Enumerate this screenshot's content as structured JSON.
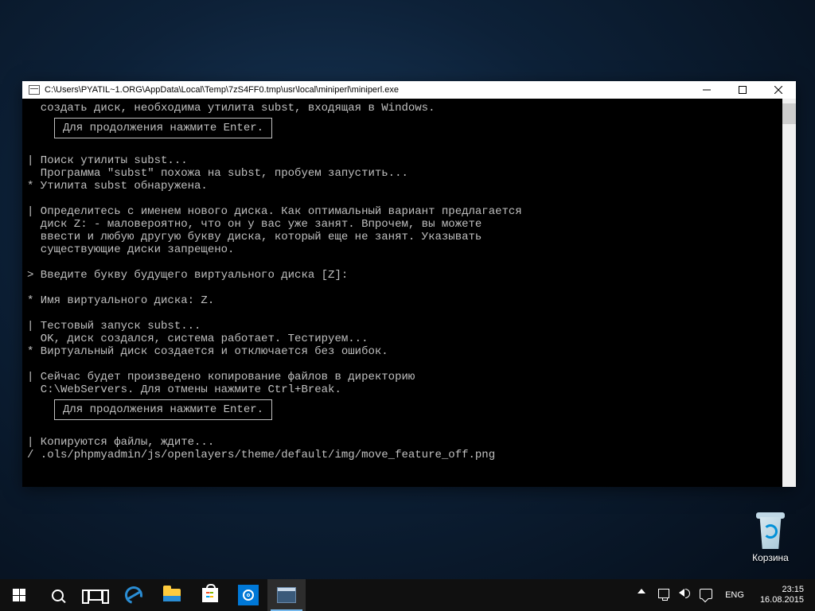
{
  "window": {
    "title": "C:\\Users\\PYATIL~1.ORG\\AppData\\Local\\Temp\\7zS4FF0.tmp\\usr\\local\\miniperl\\miniperl.exe"
  },
  "console": {
    "lines": [
      {
        "p": "  ",
        "t": "создать диск, необходима утилита subst, входящая в Windows."
      },
      {
        "box": true,
        "t": "Для продолжения нажмите Enter."
      },
      {
        "blank": true
      },
      {
        "p": "| ",
        "t": "Поиск утилиты subst..."
      },
      {
        "p": "  ",
        "t": "Программа \"subst\" похожа на subst, пробуем запустить..."
      },
      {
        "p": "* ",
        "t": "Утилита subst обнаружена."
      },
      {
        "blank": true
      },
      {
        "p": "| ",
        "t": "Определитесь с именем нового диска. Как оптимальный вариант предлагается"
      },
      {
        "p": "  ",
        "t": "диск Z: - маловероятно, что он у вас уже занят. Впрочем, вы можете"
      },
      {
        "p": "  ",
        "t": "ввести и любую другую букву диска, который еще не занят. Указывать"
      },
      {
        "p": "  ",
        "t": "существующие диски запрещено."
      },
      {
        "blank": true
      },
      {
        "p": "> ",
        "t": "Введите букву будущего виртуального диска [Z]:"
      },
      {
        "blank": true
      },
      {
        "p": "* ",
        "t": "Имя виртуального диска: Z."
      },
      {
        "blank": true
      },
      {
        "p": "| ",
        "t": "Тестовый запуск subst..."
      },
      {
        "p": "  ",
        "t": "OK, диск создался, система работает. Тестируем..."
      },
      {
        "p": "* ",
        "t": "Виртуальный диск создается и отключается без ошибок."
      },
      {
        "blank": true
      },
      {
        "p": "| ",
        "t": "Сейчас будет произведено копирование файлов в директорию"
      },
      {
        "p": "  ",
        "t": "C:\\WebServers. Для отмены нажмите Ctrl+Break."
      },
      {
        "box": true,
        "t": "Для продолжения нажмите Enter."
      },
      {
        "blank": true
      },
      {
        "p": "| ",
        "t": "Копируются файлы, ждите..."
      },
      {
        "p": "/ ",
        "t": ".ols/phpmyadmin/js/openlayers/theme/default/img/move_feature_off.png"
      }
    ]
  },
  "desktop": {
    "recycle_label": "Корзина"
  },
  "tray": {
    "lang": "ENG",
    "time": "23:15",
    "date": "16.08.2015"
  }
}
